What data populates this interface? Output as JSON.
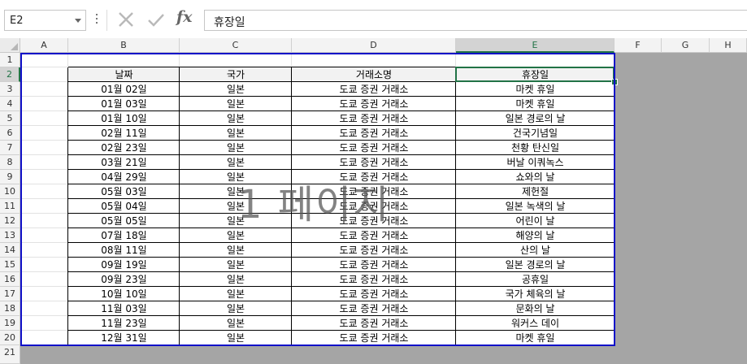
{
  "formula_bar": {
    "name_box": "E2",
    "formula": "휴장일"
  },
  "columns": [
    "A",
    "B",
    "C",
    "D",
    "E",
    "F",
    "G",
    "H"
  ],
  "rows": [
    "1",
    "2",
    "3",
    "4",
    "5",
    "6",
    "7",
    "8",
    "9",
    "10",
    "11",
    "12",
    "13",
    "14",
    "15",
    "16",
    "17",
    "18",
    "19",
    "20",
    "21"
  ],
  "table": {
    "headers": [
      "날짜",
      "국가",
      "거래소명",
      "휴장일"
    ],
    "rows": [
      [
        "01월 02일",
        "일본",
        "도쿄 증권 거래소",
        "마켓 휴일"
      ],
      [
        "01월 03일",
        "일본",
        "도쿄 증권 거래소",
        "마켓 휴일"
      ],
      [
        "01월 10일",
        "일본",
        "도쿄 증권 거래소",
        "일본 경로의 날"
      ],
      [
        "02월 11일",
        "일본",
        "도쿄 증권 거래소",
        "건국기념일"
      ],
      [
        "02월 23일",
        "일본",
        "도쿄 증권 거래소",
        "천황 탄신일"
      ],
      [
        "03월 21일",
        "일본",
        "도쿄 증권 거래소",
        "버날 이쿼녹스"
      ],
      [
        "04월 29일",
        "일본",
        "도쿄 증권 거래소",
        "쇼와의 날"
      ],
      [
        "05월 03일",
        "일본",
        "도쿄 증권 거래소",
        "제헌절"
      ],
      [
        "05월 04일",
        "일본",
        "도쿄 증권 거래소",
        "일본 녹색의 날"
      ],
      [
        "05월 05일",
        "일본",
        "도쿄 증권 거래소",
        "어린이 날"
      ],
      [
        "07월 18일",
        "일본",
        "도쿄 증권 거래소",
        "해양의 날"
      ],
      [
        "08월 11일",
        "일본",
        "도쿄 증권 거래소",
        "산의 날"
      ],
      [
        "09월 19일",
        "일본",
        "도쿄 증권 거래소",
        "일본 경로의 날"
      ],
      [
        "09월 23일",
        "일본",
        "도쿄 증권 거래소",
        "공휴일"
      ],
      [
        "10월 10일",
        "일본",
        "도쿄 증권 거래소",
        "국가 체육의 날"
      ],
      [
        "11월 03일",
        "일본",
        "도쿄 증권 거래소",
        "문화의 날"
      ],
      [
        "11월 23일",
        "일본",
        "도쿄 증권 거래소",
        "워커스 데이"
      ],
      [
        "12월 31일",
        "일본",
        "도쿄 증권 거래소",
        "마켓 휴일"
      ]
    ]
  },
  "page_watermark": "1 페이지",
  "selected_cell": "E2",
  "colors": {
    "accent": "#217346",
    "print_area_border": "#1010c8",
    "outside_print_area": "#a5a5a5",
    "header_fill": "#f2f2f2"
  },
  "icons": {
    "cancel": "close-icon",
    "enter": "check-icon",
    "function": "fx-icon",
    "name_box_dropdown": "chevron-down-icon"
  }
}
